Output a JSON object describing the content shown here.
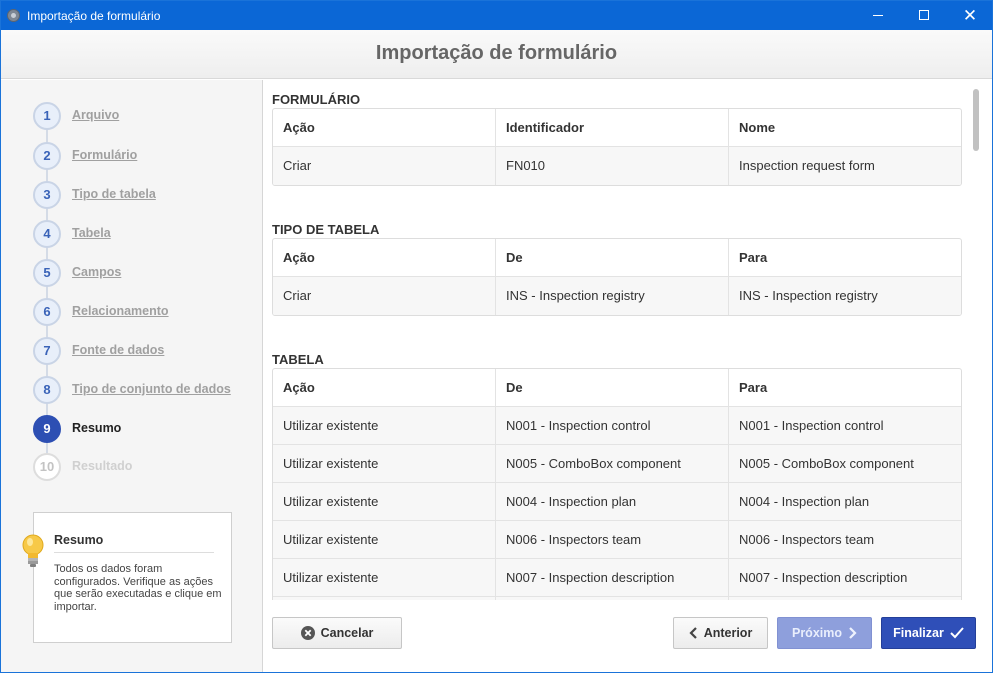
{
  "window": {
    "title": "Importação de formulário"
  },
  "header": {
    "title": "Importação de formulário"
  },
  "steps": [
    {
      "num": "1",
      "label": "Arquivo",
      "state": "done"
    },
    {
      "num": "2",
      "label": "Formulário",
      "state": "done"
    },
    {
      "num": "3",
      "label": "Tipo de tabela",
      "state": "done"
    },
    {
      "num": "4",
      "label": "Tabela",
      "state": "done"
    },
    {
      "num": "5",
      "label": "Campos",
      "state": "done"
    },
    {
      "num": "6",
      "label": "Relacionamento",
      "state": "done"
    },
    {
      "num": "7",
      "label": "Fonte de dados",
      "state": "done"
    },
    {
      "num": "8",
      "label": "Tipo de conjunto de dados",
      "state": "done"
    },
    {
      "num": "9",
      "label": "Resumo",
      "state": "active"
    },
    {
      "num": "10",
      "label": "Resultado",
      "state": "disabled"
    }
  ],
  "help": {
    "title": "Resumo",
    "text": "Todos os dados foram configurados. Verifique as ações que serão executadas e clique em importar."
  },
  "sections": {
    "formulario": {
      "title": "FORMULÁRIO",
      "headers": [
        "Ação",
        "Identificador",
        "Nome"
      ],
      "rows": [
        [
          "Criar",
          "FN010",
          "Inspection request form"
        ]
      ]
    },
    "tipo_tabela": {
      "title": "TIPO DE TABELA",
      "headers": [
        "Ação",
        "De",
        "Para"
      ],
      "rows": [
        [
          "Criar",
          "INS - Inspection registry",
          "INS - Inspection registry"
        ]
      ]
    },
    "tabela": {
      "title": "TABELA",
      "headers": [
        "Ação",
        "De",
        "Para"
      ],
      "rows": [
        [
          "Utilizar existente",
          "N001 - Inspection control",
          "N001 - Inspection control"
        ],
        [
          "Utilizar existente",
          "N005 - ComboBox component",
          "N005 - ComboBox component"
        ],
        [
          "Utilizar existente",
          "N004 - Inspection plan",
          "N004 - Inspection plan"
        ],
        [
          "Utilizar existente",
          "N006 - Inspectors team",
          "N006 - Inspectors team"
        ],
        [
          "Utilizar existente",
          "N007 - Inspection description",
          "N007 - Inspection description"
        ]
      ]
    }
  },
  "footer": {
    "cancel_label": "Cancelar",
    "prev_label": "Anterior",
    "next_label": "Próximo",
    "finish_label": "Finalizar"
  },
  "colors": {
    "titlebar": "#0b67d6",
    "accent": "#2f4fb8",
    "next_disabled": "#8e9fdc"
  }
}
